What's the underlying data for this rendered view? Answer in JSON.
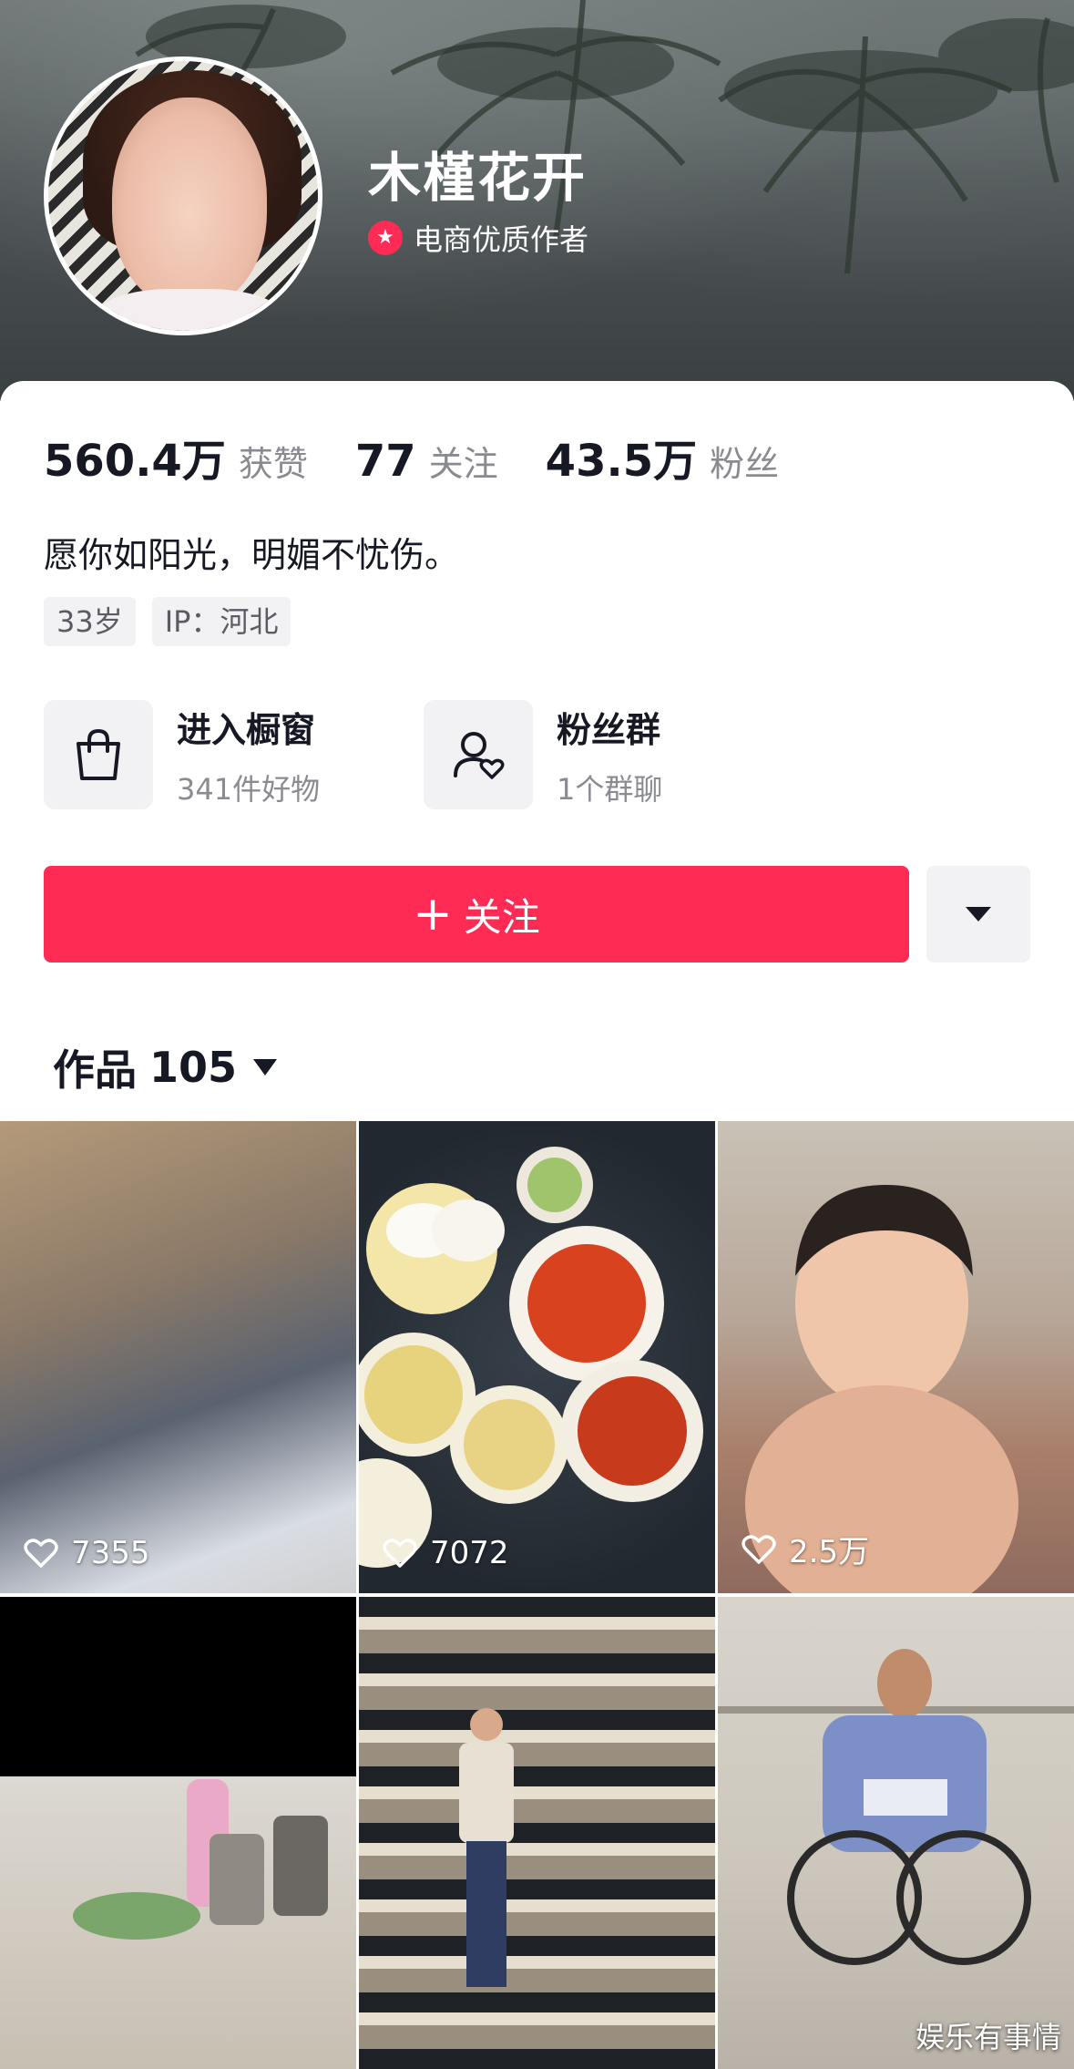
{
  "profile": {
    "name": "木槿花开",
    "badge_icon": "star-badge-icon",
    "badge_text": "电商优质作者"
  },
  "stats": [
    {
      "num": "560.4万",
      "label": "获赞"
    },
    {
      "num": "77",
      "label": "关注"
    },
    {
      "num": "43.5万",
      "label": "粉丝"
    }
  ],
  "bio": "愿你如阳光，明媚不忧伤。",
  "tags": [
    "33岁",
    "IP：河北"
  ],
  "entries": {
    "shop": {
      "icon": "shopping-bag-icon",
      "title": "进入橱窗",
      "sub": "341件好物"
    },
    "fans": {
      "icon": "fan-group-icon",
      "title": "粉丝群",
      "sub": "1个群聊"
    }
  },
  "actions": {
    "follow_plus": "+",
    "follow_label": "关注",
    "more_icon": "caret-down-icon"
  },
  "works": {
    "label": "作品",
    "count": "105"
  },
  "videos": [
    {
      "likes": "7355"
    },
    {
      "likes": "7072"
    },
    {
      "likes": "2.5万"
    },
    {
      "likes": ""
    },
    {
      "likes": ""
    },
    {
      "likes": ""
    }
  ],
  "watermark": "娱乐有事情",
  "colors": {
    "accent": "#fe2c55",
    "text_primary": "#161823",
    "text_secondary": "#8a8b91",
    "chip_bg": "#f2f2f4"
  }
}
